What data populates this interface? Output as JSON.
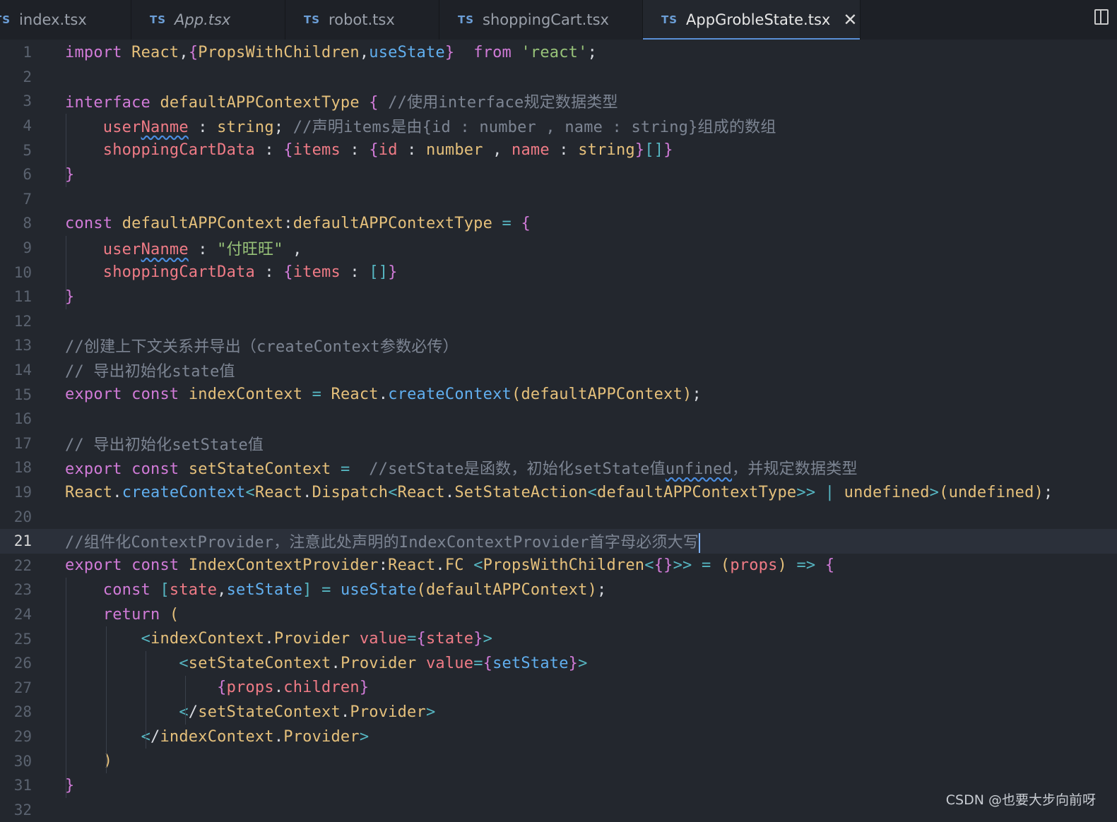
{
  "tabs": [
    {
      "lang": "TS",
      "label": "index.tsx",
      "active": false
    },
    {
      "lang": "TS",
      "label": "App.tsx",
      "active": false
    },
    {
      "lang": "TS",
      "label": "robot.tsx",
      "active": false
    },
    {
      "lang": "TS",
      "label": "shoppingCart.tsx",
      "active": false
    },
    {
      "lang": "TS",
      "label": "AppGrobleState.tsx",
      "active": true
    }
  ],
  "close_glyph": "✕",
  "current_line": 21,
  "line_numbers": [
    "1",
    "2",
    "3",
    "4",
    "5",
    "6",
    "7",
    "8",
    "9",
    "10",
    "11",
    "12",
    "13",
    "14",
    "15",
    "16",
    "17",
    "18",
    "19",
    "20",
    "21",
    "22",
    "23",
    "24",
    "25",
    "26",
    "27",
    "28",
    "29",
    "30",
    "31",
    "32"
  ],
  "lines": [
    "import React,{PropsWithChildren,useState}  from 'react';",
    "",
    "interface defaultAPPContextType { //使用interface规定数据类型",
    "    userNanme : string; //声明items是由{id : number , name : string}组成的数组",
    "    shoppingCartData : {items : {id : number , name : string}[]}",
    "}",
    "",
    "const defaultAPPContext:defaultAPPContextType = {",
    "    userNanme : \"付旺旺\" ,",
    "    shoppingCartData : {items : []}",
    "}",
    "",
    "//创建上下文关系并导出（createContext参数必传）",
    "// 导出初始化state值",
    "export const indexContext = React.createContext(defaultAPPContext);",
    "",
    "// 导出初始化setState值",
    "export const setStateContext =  //setState是函数，初始化setState值unfined，并规定数据类型",
    "React.createContext<React.Dispatch<React.SetStateAction<defaultAPPContextType>> | undefined>(undefined);",
    "",
    "//组件化ContextProvider，注意此处声明的IndexContextProvider首字母必须大写",
    "export const IndexContextProvider:React.FC <PropsWithChildren<{}>> = (props) => {",
    "    const [state,setState] = useState(defaultAPPContext);",
    "    return (",
    "        <indexContext.Provider value={state}>",
    "            <setStateContext.Provider value={setState}>",
    "                {props.children}",
    "            </setStateContext.Provider>",
    "        </indexContext.Provider>",
    "    )",
    "}",
    ""
  ],
  "watermark": "CSDN @也要大步向前呀",
  "colors": {
    "background": "#23272e",
    "keyword": "#d17bd8",
    "type": "#e5c07b",
    "variable": "#ef7b86",
    "string": "#98c379",
    "function": "#61afef",
    "comment": "#7d8593",
    "tab_accent": "#5a8fd6"
  }
}
